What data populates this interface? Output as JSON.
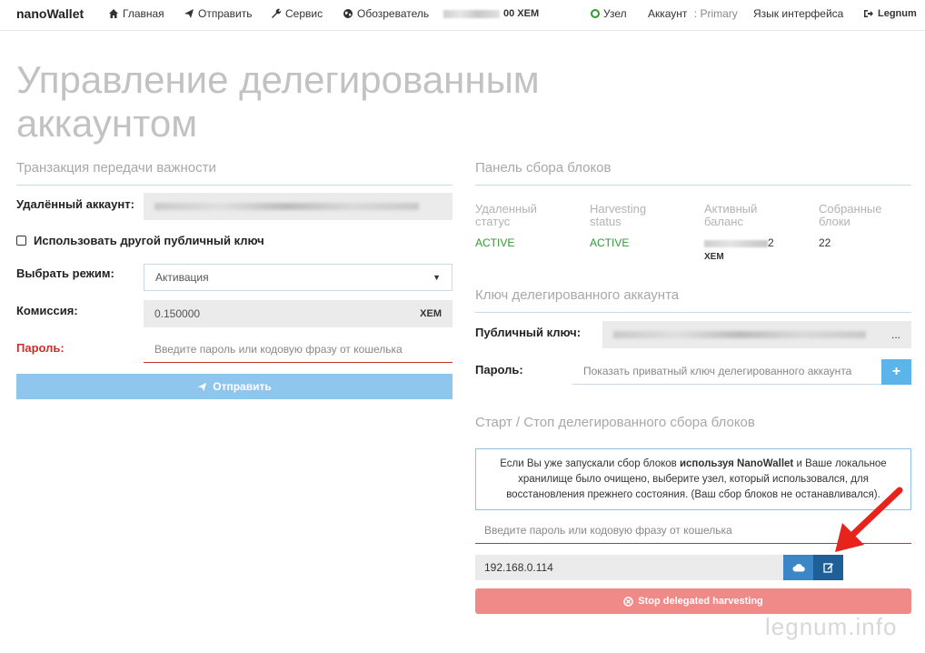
{
  "nav": {
    "brand": "nanoWallet",
    "home": "Главная",
    "send": "Отправить",
    "services": "Сервис",
    "explorer": "Обозреватель",
    "balance_suffix": "00 XEM",
    "node": "Узел",
    "account_label": "Аккаунт",
    "account_sep": " : ",
    "account_value": "Primary",
    "language": "Язык интерфейса",
    "logout": "Legnum"
  },
  "page": {
    "title": "Управление делегированным аккаунтом"
  },
  "left": {
    "heading": "Транзакция передачи важности",
    "remote_account_label": "Удалённый аккаунт:",
    "use_other_key_label": "Использовать другой публичный ключ",
    "mode_label": "Выбрать режим:",
    "mode_value": "Активация",
    "fee_label": "Комиссия:",
    "fee_value": "0.150000",
    "fee_unit": "XEM",
    "password_label": "Пароль:",
    "password_placeholder": "Введите пароль или кодовую фразу от кошелька",
    "send_button": "Отправить"
  },
  "right": {
    "harvest_heading": "Панель сбора блоков",
    "stats": [
      {
        "header": "Удаленный статус",
        "value": "ACTIVE"
      },
      {
        "header": "Harvesting status",
        "value": "ACTIVE"
      },
      {
        "header": "Активный баланс",
        "value_suffix": "2",
        "unit": "XEM"
      },
      {
        "header": "Собранные блоки",
        "value": "22"
      }
    ],
    "delegated_key_heading": "Ключ делегированного аккаунта",
    "public_key_label": "Публичный ключ:",
    "public_key_ellipsis": "...",
    "password_label": "Пароль:",
    "show_private_key_placeholder": "Показать приватный ключ делегированного аккаунта",
    "plus_button": "+",
    "startstop_heading": "Старт / Стоп делегированного сбора блоков",
    "info_part1": "Если Вы уже запускали сбор блоков ",
    "info_bold": "используя NanoWallet",
    "info_part2": " и Ваше локальное хранилище было очищено, выберите узел, который использовался, для восстановления прежнего состояния. (Ваш сбор блоков не останавливался).",
    "wallet_password_placeholder": "Введите пароль или кодовую фразу от кошелька",
    "node_value": "192.168.0.114",
    "stop_button": "Stop delegated harvesting"
  },
  "watermark": "legnum.info",
  "colors": {
    "active": "#2e9b32",
    "primary_light": "#8fc6ee",
    "danger_light": "#ef8a88",
    "arrow": "#e8231c"
  }
}
